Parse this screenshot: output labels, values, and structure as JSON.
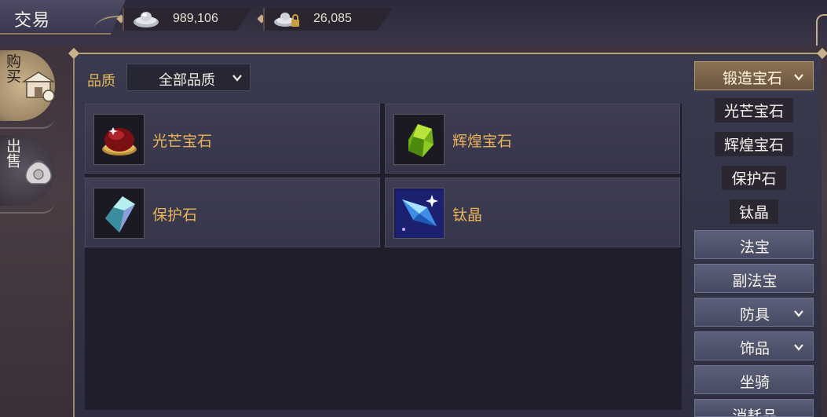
{
  "app": {
    "title": "交易"
  },
  "currencies": [
    {
      "icon": "silver-ingot-icon",
      "value": "989,106"
    },
    {
      "icon": "locked-silver-ingot-icon",
      "value": "26,085"
    }
  ],
  "side_tabs": [
    {
      "label": "购买",
      "icon": "shop-icon",
      "active": true
    },
    {
      "label": "出售",
      "icon": "money-bag-icon",
      "active": false
    }
  ],
  "filter": {
    "label": "品质",
    "selected": "全部品质"
  },
  "items": [
    {
      "name": "光芒宝石",
      "icon": "red-gem-icon"
    },
    {
      "name": "辉煌宝石",
      "icon": "green-gem-icon"
    },
    {
      "name": "保护石",
      "icon": "cyan-crystal-icon"
    },
    {
      "name": "钛晶",
      "icon": "blue-crystal-icon"
    }
  ],
  "categories": {
    "active_group": "锻造宝石",
    "sub_items": [
      "光芒宝石",
      "辉煌宝石",
      "保护石",
      "钛晶"
    ],
    "groups": [
      {
        "label": "法宝",
        "expandable": false
      },
      {
        "label": "副法宝",
        "expandable": false
      },
      {
        "label": "防具",
        "expandable": true
      },
      {
        "label": "饰品",
        "expandable": true
      },
      {
        "label": "坐骑",
        "expandable": false
      },
      {
        "label": "消耗品",
        "expandable": false
      }
    ]
  },
  "colors": {
    "accent_gold": "#e9b35a",
    "active_tab": "#8c7253",
    "panel_bg": "#2e2e40"
  }
}
